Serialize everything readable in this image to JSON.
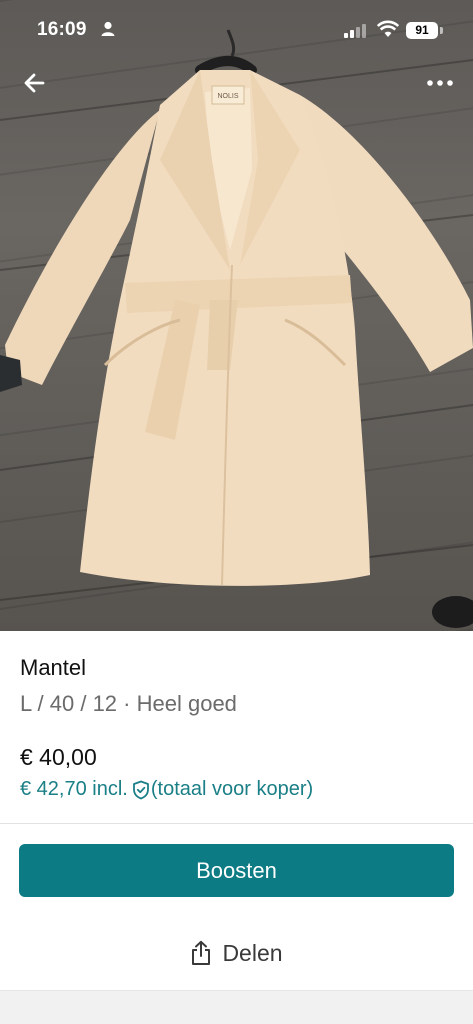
{
  "status_bar": {
    "time": "16:09",
    "battery": "91"
  },
  "photo": {
    "tag_text": "NOLIS",
    "icons": {
      "back": "arrow-left-icon",
      "more": "more-dots-icon"
    }
  },
  "item": {
    "title": "Mantel",
    "size_label": "L / 40 / 12",
    "separator": " · ",
    "condition": "Heel goed",
    "price": "€ 40,00",
    "price_incl_amount": "€ 42,70 incl.",
    "price_incl_note": "(totaal voor koper)"
  },
  "actions": {
    "boost_label": "Boosten",
    "share_label": "Delen"
  },
  "colors": {
    "accent": "#0d7b84",
    "link": "#1a7f86",
    "coat": "#f2dcc0"
  }
}
